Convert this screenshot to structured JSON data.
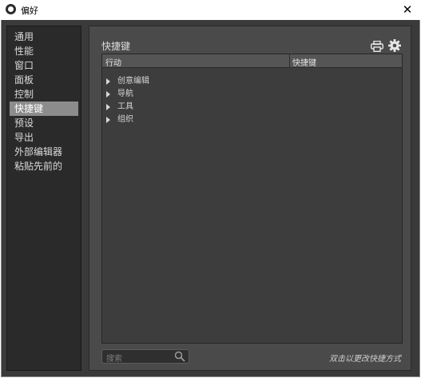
{
  "window": {
    "title": "偏好",
    "close_glyph": "✕"
  },
  "sidebar": {
    "items": [
      {
        "label": "通用",
        "active": false
      },
      {
        "label": "性能",
        "active": false
      },
      {
        "label": "窗口",
        "active": false
      },
      {
        "label": "面板",
        "active": false
      },
      {
        "label": "控制",
        "active": false
      },
      {
        "label": "快捷键",
        "active": true
      },
      {
        "label": "预设",
        "active": false
      },
      {
        "label": "导出",
        "active": false
      },
      {
        "label": "外部编辑器",
        "active": false
      },
      {
        "label": "粘贴先前的",
        "active": false
      }
    ]
  },
  "panel": {
    "title": "快捷键",
    "toolbar_icons": [
      "printer-icon",
      "gear-icon"
    ],
    "table": {
      "columns": [
        "行动",
        "快捷键"
      ],
      "rows": [
        {
          "label": "创意编辑",
          "expanded": false
        },
        {
          "label": "导航",
          "expanded": false
        },
        {
          "label": "工具",
          "expanded": false
        },
        {
          "label": "组织",
          "expanded": false
        }
      ]
    },
    "search": {
      "placeholder": "搜索"
    },
    "hint": "双击以更改快捷方式"
  },
  "colors": {
    "window_bg": "#3a3a3a",
    "sidebar_bg": "#2a2a2a",
    "active_item": "#8c8c8c",
    "panel_bg": "#4a4a4a",
    "table_bg": "#3d3d3d",
    "header_bg": "#555555"
  }
}
